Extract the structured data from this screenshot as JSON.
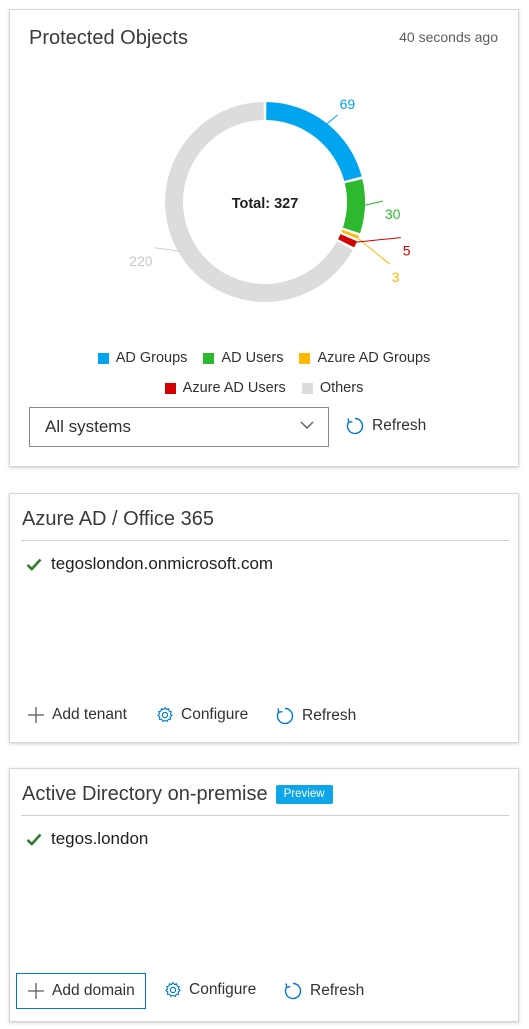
{
  "protected_objects": {
    "title": "Protected Objects",
    "timestamp": "40 seconds ago",
    "total_label": "Total: 327",
    "chart_data": {
      "type": "pie",
      "variant": "donut",
      "title": "Total: 327",
      "slices": [
        {
          "name": "AD Groups",
          "value": 69,
          "color": "#00a4ef"
        },
        {
          "name": "AD Users",
          "value": 30,
          "color": "#2db92d"
        },
        {
          "name": "Azure AD Groups",
          "value": 3,
          "color": "#ffb900"
        },
        {
          "name": "Azure AD Users",
          "value": 5,
          "color": "#d40000"
        },
        {
          "name": "Others",
          "value": 220,
          "color": "#dcdcdc"
        }
      ],
      "data_labels": [
        "69",
        "30",
        "3",
        "5",
        "220"
      ]
    },
    "legend": [
      "AD Groups",
      "AD Users",
      "Azure AD Groups",
      "Azure AD Users",
      "Others"
    ],
    "system_select": {
      "value": "All systems",
      "icon": "chevron-down-icon"
    },
    "refresh_label": "Refresh"
  },
  "azure_section": {
    "title": "Azure AD / Office 365",
    "items": [
      {
        "label": "tegoslondon.onmicrosoft.com",
        "status_icon": "check-icon",
        "status_color": "#2e7d32"
      }
    ],
    "actions": {
      "add": "Add tenant",
      "configure": "Configure",
      "refresh": "Refresh"
    }
  },
  "ad_section": {
    "title": "Active Directory on-premise",
    "badge": "Preview",
    "items": [
      {
        "label": "tegos.london",
        "status_icon": "check-icon",
        "status_color": "#2e7d32"
      }
    ],
    "actions": {
      "add": "Add domain",
      "configure": "Configure",
      "refresh": "Refresh"
    }
  },
  "colors": {
    "accent": "#0078d4",
    "badge": "#0ea5e9"
  }
}
